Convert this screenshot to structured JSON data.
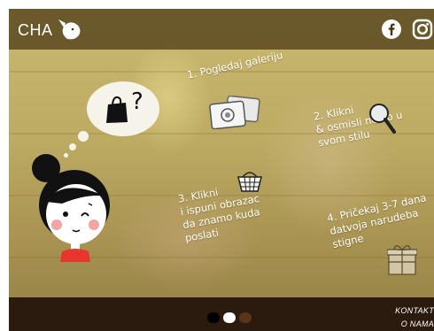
{
  "header": {
    "logo_text": "CHA",
    "logo_icon": "fox-head-icon",
    "social": [
      {
        "name": "facebook-icon"
      },
      {
        "name": "instagram-icon"
      }
    ]
  },
  "steps": [
    {
      "text": "1. Pogledaj galeriju",
      "icon": "gallery-photos-icon"
    },
    {
      "text": "2. Klikni\n& osmisli nešto u\nsvom stilu",
      "icon": "magnifier-icon"
    },
    {
      "text": "3. Klikni\ni ispuni obrazac\nda znamo kuda\nposlati",
      "icon": "basket-icon"
    },
    {
      "text": "4. Pričekaj 3-7 dana\ndatvoja narudeba\nstigne",
      "icon": "gift-box-icon"
    }
  ],
  "illustration": {
    "thought_bubble_symbol": "?",
    "bubble_icon": "shopping-bag-icon",
    "character": "girl-icon"
  },
  "footer": {
    "links": [
      "KONTAKT",
      "O NAMA"
    ],
    "pagination": {
      "count": 3,
      "active_index": 1
    }
  },
  "colors": {
    "topbar": "#46340f",
    "footer": "#2b1a0e",
    "hero": "#bdab63"
  }
}
